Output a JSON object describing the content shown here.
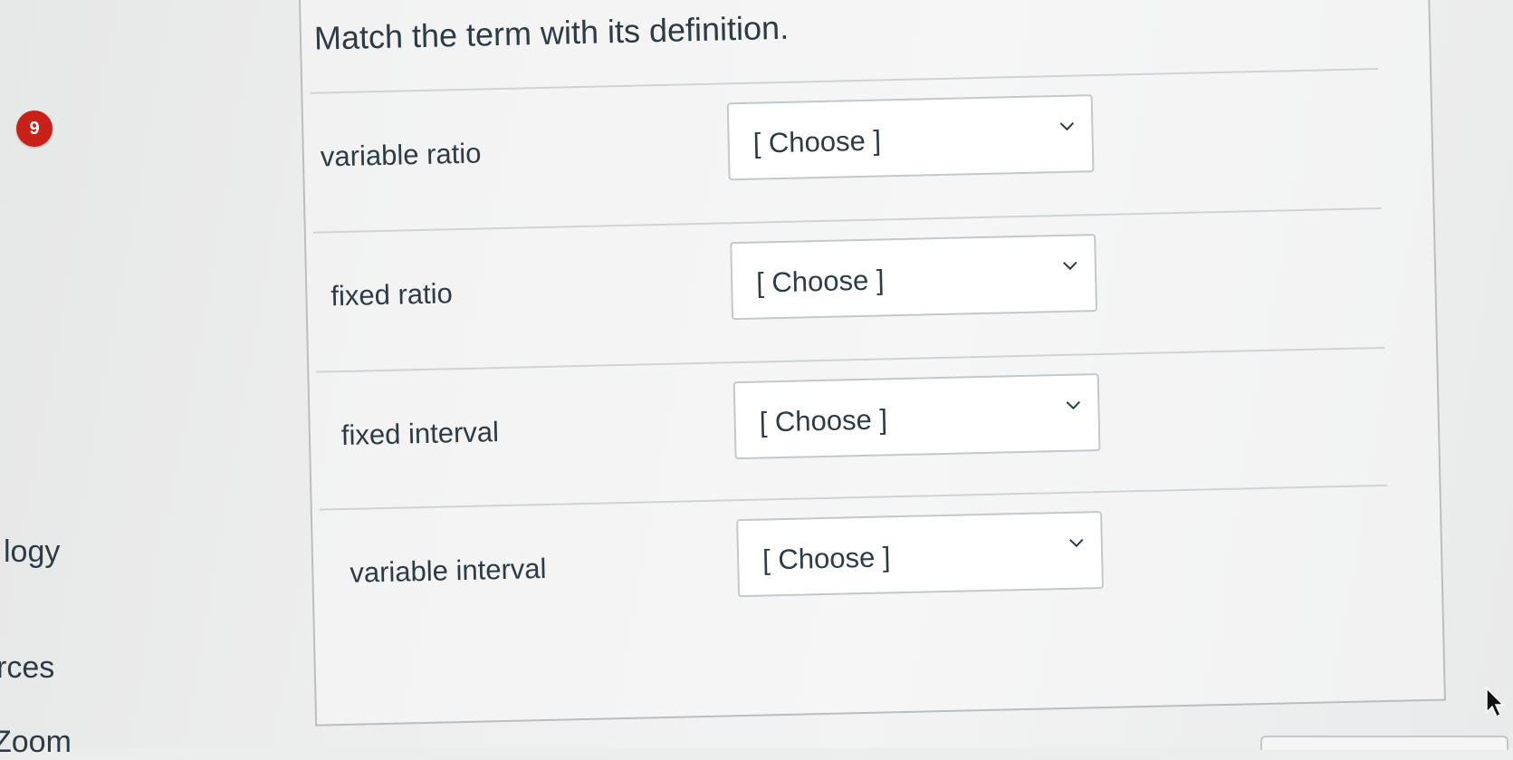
{
  "question": {
    "number": "9",
    "title": "Match the term with its definition."
  },
  "left_nav": {
    "items": [
      "logy",
      "rces",
      "Zoom"
    ]
  },
  "rows": [
    {
      "term": "variable ratio",
      "selected": "[ Choose ]"
    },
    {
      "term": "fixed ratio",
      "selected": "[ Choose ]"
    },
    {
      "term": "fixed interval",
      "selected": "[ Choose ]"
    },
    {
      "term": "variable interval",
      "selected": "[ Choose ]"
    }
  ],
  "icons": {
    "dropdown": "chevron-down-icon",
    "pointer": "mouse-cursor-icon"
  },
  "colors": {
    "badge": "#c9211a",
    "text": "#2d3b45",
    "border": "#c3c8cc"
  }
}
